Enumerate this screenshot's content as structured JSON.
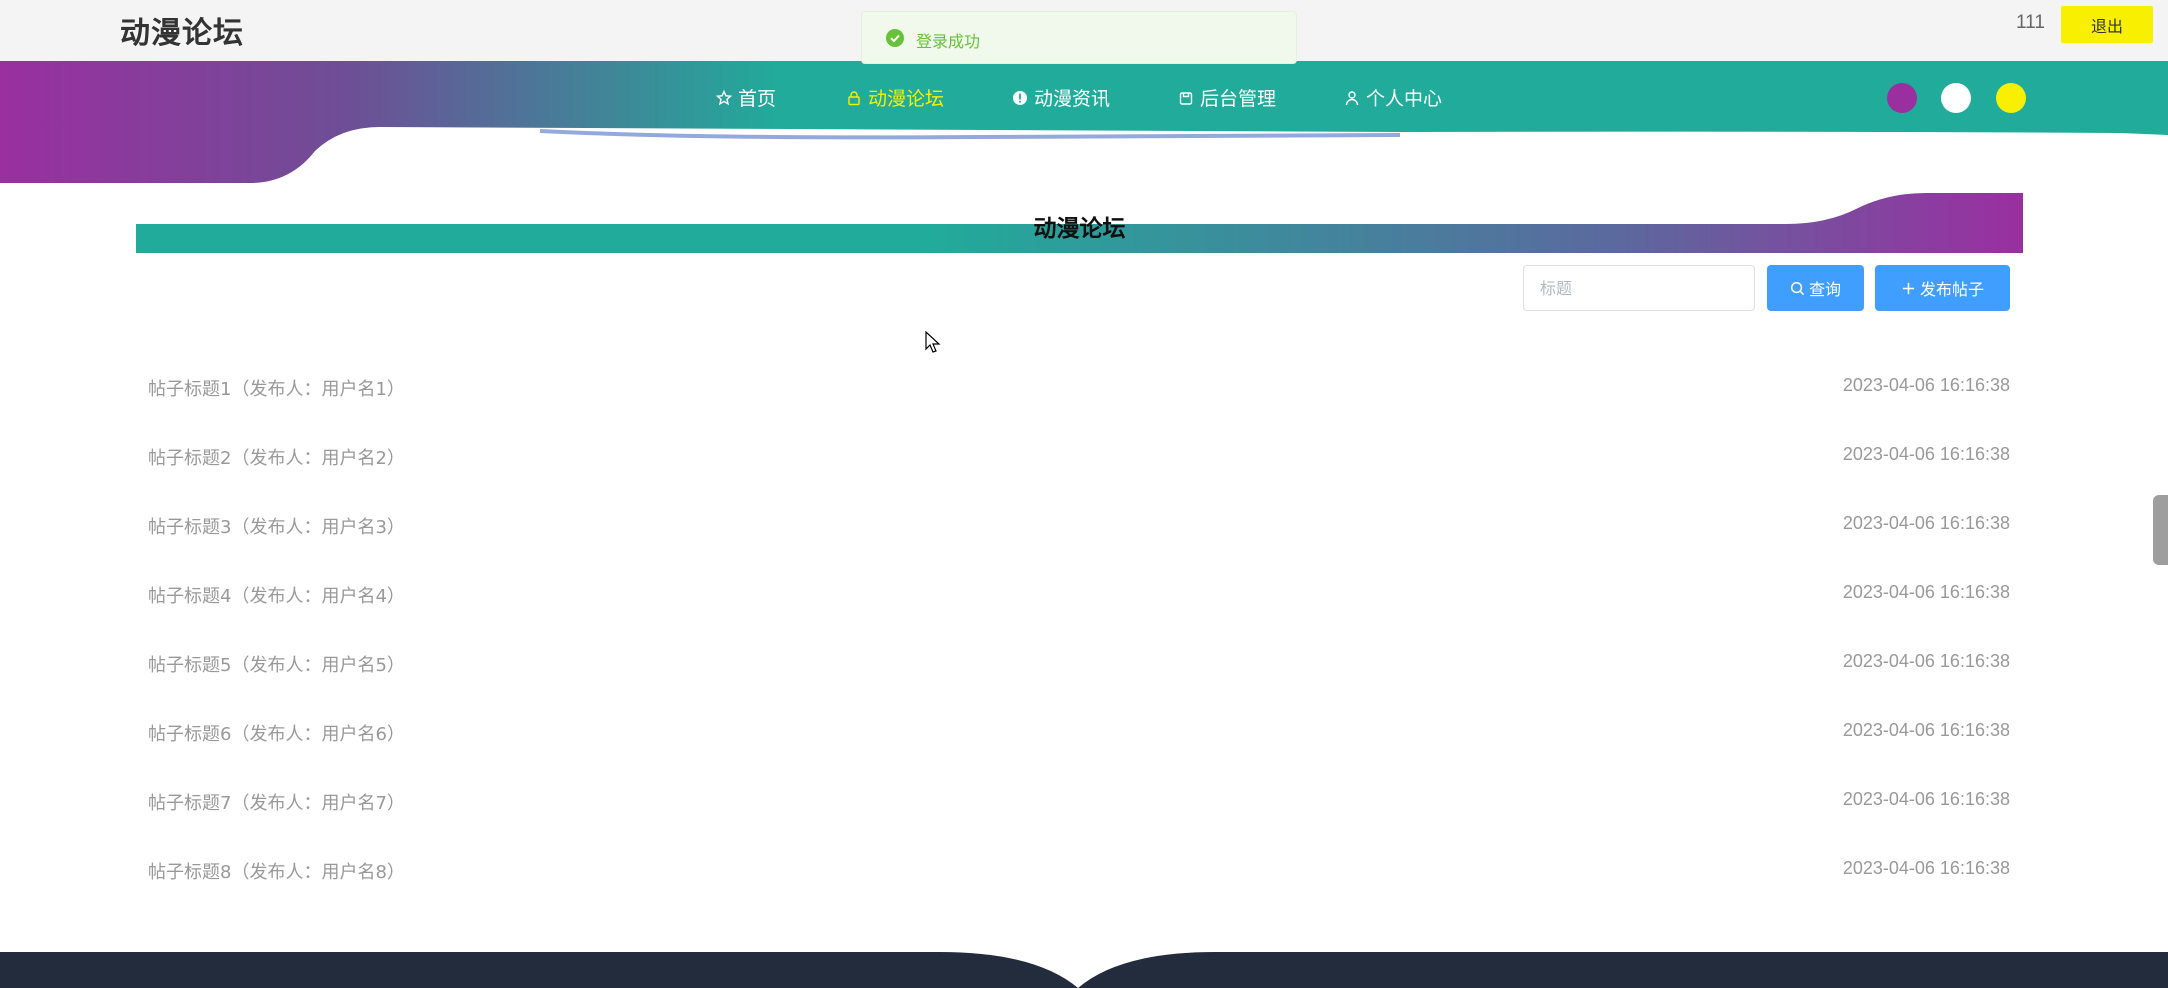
{
  "header": {
    "site_title": "动漫论坛",
    "user_name": "111",
    "logout_label": "退出"
  },
  "toast": {
    "message": "登录成功"
  },
  "nav": {
    "items": [
      {
        "label": "首页",
        "icon": "star-icon"
      },
      {
        "label": "动漫论坛",
        "icon": "lock-icon",
        "active": true
      },
      {
        "label": "动漫资讯",
        "icon": "info-icon"
      },
      {
        "label": "后台管理",
        "icon": "briefcase-icon"
      },
      {
        "label": "个人中心",
        "icon": "user-icon"
      }
    ],
    "theme_colors": [
      "#9a2fa0",
      "#ffffff",
      "#f8f000"
    ]
  },
  "section": {
    "title": "动漫论坛"
  },
  "search": {
    "placeholder": "标题",
    "query_label": "查询",
    "post_label": "发布帖子"
  },
  "posts": [
    {
      "title": "帖子标题1（发布人：用户名1）",
      "time": "2023-04-06 16:16:38"
    },
    {
      "title": "帖子标题2（发布人：用户名2）",
      "time": "2023-04-06 16:16:38"
    },
    {
      "title": "帖子标题3（发布人：用户名3）",
      "time": "2023-04-06 16:16:38"
    },
    {
      "title": "帖子标题4（发布人：用户名4）",
      "time": "2023-04-06 16:16:38"
    },
    {
      "title": "帖子标题5（发布人：用户名5）",
      "time": "2023-04-06 16:16:38"
    },
    {
      "title": "帖子标题6（发布人：用户名6）",
      "time": "2023-04-06 16:16:38"
    },
    {
      "title": "帖子标题7（发布人：用户名7）",
      "time": "2023-04-06 16:16:38"
    },
    {
      "title": "帖子标题8（发布人：用户名8）",
      "time": "2023-04-06 16:16:38"
    }
  ],
  "colors": {
    "teal": "#21ab9a",
    "purple": "#9a2fa0",
    "accent_yellow": "#f8f000",
    "button_blue": "#409eff",
    "footer_dark": "#232c3d"
  }
}
